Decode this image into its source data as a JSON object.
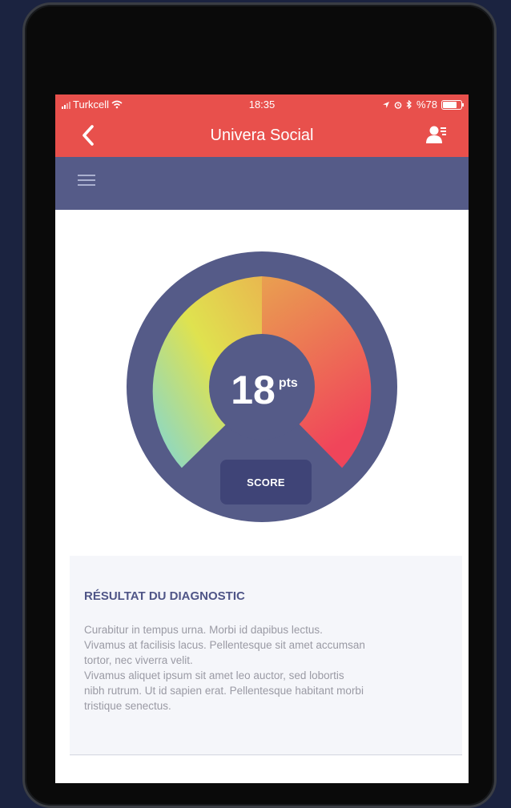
{
  "status_bar": {
    "carrier": "Turkcell",
    "time": "18:35",
    "battery": "%78"
  },
  "header": {
    "title": "Univera Social",
    "back_icon": "chevron-left-icon",
    "profile_icon": "user-list-icon"
  },
  "menu": {
    "icon": "hamburger-icon"
  },
  "gauge": {
    "score": "18",
    "unit": "pts",
    "button_label": "SCORE",
    "colors": [
      "#7fd6d8",
      "#dfe24f",
      "#e9a050",
      "#f0455a"
    ],
    "background": "#555b88"
  },
  "result": {
    "title": "RÉSULTAT DU DIAGNOSTIC",
    "lines": [
      "Curabitur in tempus urna. Morbi id dapibus lectus.",
      "Vivamus at facilisis lacus. Pellentesque sit amet accumsan",
      "tortor, nec viverra velit.",
      "Vivamus aliquet ipsum sit amet leo auctor, sed lobortis",
      "nibh rutrum. Ut id sapien erat. Pellentesque habitant morbi",
      "tristique senectus."
    ]
  },
  "colors": {
    "brand_red": "#e8504c",
    "brand_indigo": "#555b88"
  }
}
